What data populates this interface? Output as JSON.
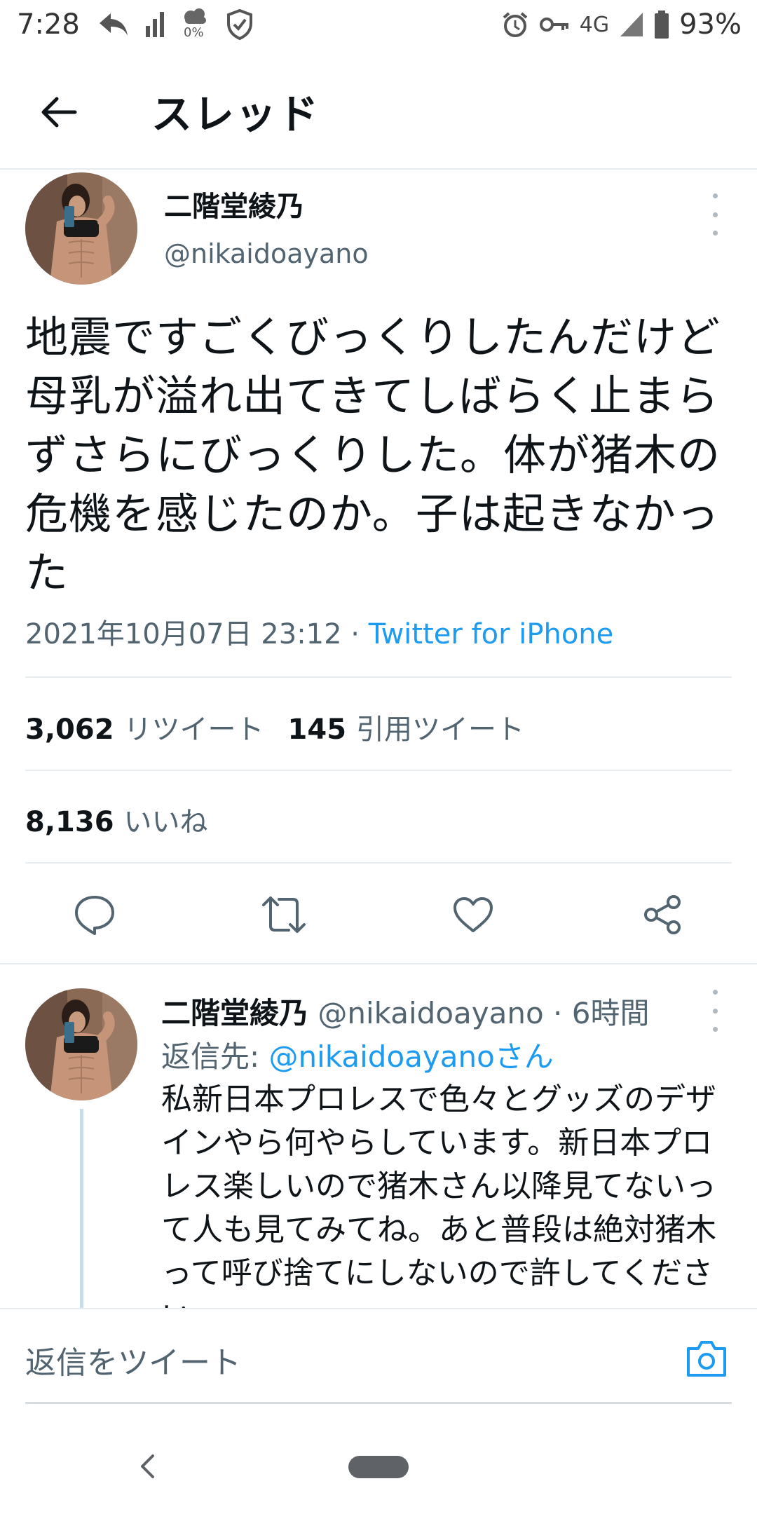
{
  "status_bar": {
    "time": "7:28",
    "data_saver_value": "0%",
    "network": "4G",
    "battery": "93%"
  },
  "app_bar": {
    "title": "スレッド"
  },
  "main_tweet": {
    "author_name": "二階堂綾乃",
    "handle": "@nikaidoayano",
    "text": "地震ですごくびっくりしたんだけど母乳が溢れ出てきてしばらく止まらずさらにびっくりした。体が猪木の危機を感じたのか。子は起きなかった",
    "timestamp": "2021年10月07日 23:12",
    "separator": " · ",
    "source": "Twitter for iPhone",
    "stats": {
      "retweets_count": "3,062",
      "retweets_label": "リツイート",
      "quotes_count": "145",
      "quotes_label": "引用ツイート",
      "likes_count": "8,136",
      "likes_label": "いいね"
    }
  },
  "reply_tweet": {
    "author_name": "二階堂綾乃",
    "handle": "@nikaidoayano",
    "time_ago": "6時間",
    "reply_to_label": "返信先:",
    "reply_to_handle": "@nikaidoayanoさん",
    "text": "私新日本プロレスで色々とグッズのデザインやら何やらしています。新日本プロレス楽しいので猪木さん以降見てないって人も見てみてね。あと普段は絶対猪木って呼び捨てにしないので許してください"
  },
  "composer": {
    "placeholder": "返信をツイート"
  },
  "icons": {
    "back": "arrow-left-icon",
    "more": "more-vertical-icon",
    "reply": "reply-icon",
    "retweet": "retweet-icon",
    "like": "heart-icon",
    "share": "share-icon",
    "camera": "camera-icon"
  },
  "colors": {
    "accent": "#1d9bf0",
    "secondary_text": "#536471",
    "divider": "#e6ecf0"
  }
}
